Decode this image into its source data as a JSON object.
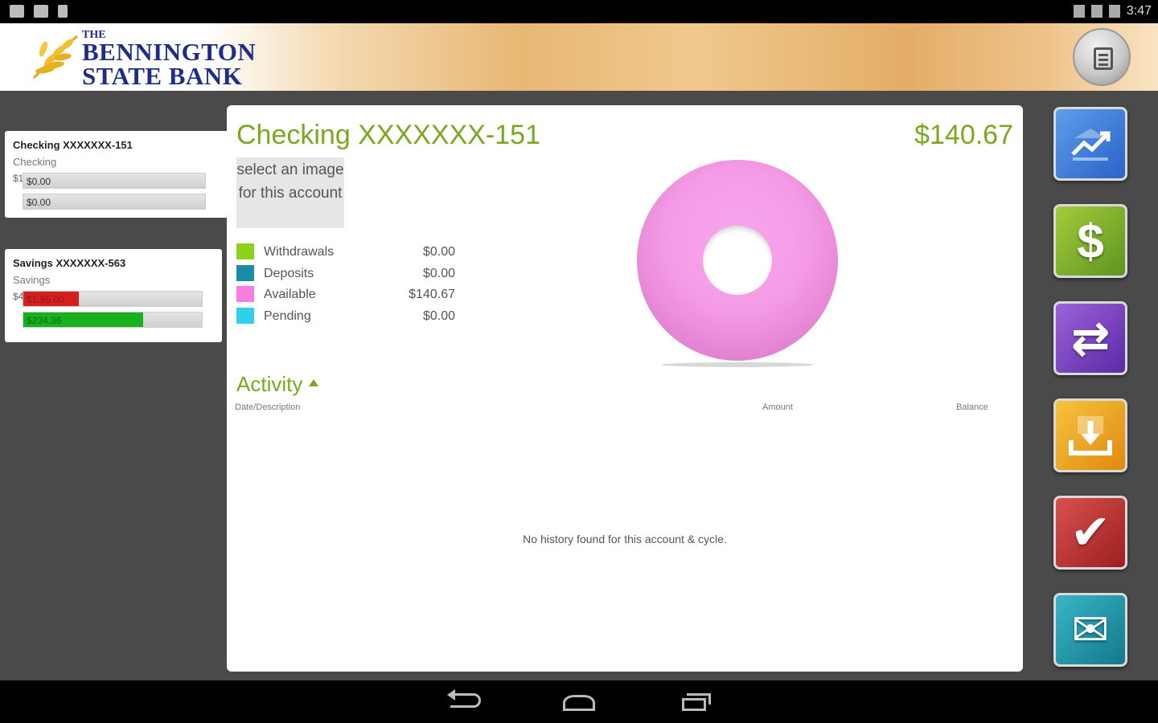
{
  "status_bar": {
    "time": "3:47"
  },
  "brand": {
    "the": "THE",
    "line1": "BENNINGTON",
    "line2": "STATE BANK"
  },
  "accounts": [
    {
      "name": "Checking XXXXXXX-151",
      "type": "Checking",
      "prefix": "$1",
      "bar1_label": "$0.00",
      "bar1_fill": 0,
      "bar2_label": "$0.00",
      "bar2_fill": 0
    },
    {
      "name": "Savings XXXXXXX-563",
      "type": "Savings",
      "prefix": "$4",
      "bar1_label": "$1.95.00",
      "bar1_fill": 0.31,
      "bar2_label": "$234.36",
      "bar2_fill": 0.67
    }
  ],
  "detail": {
    "title": "Checking XXXXXXX-151",
    "balance": "$140.67",
    "image_placeholder": "select an image for this account",
    "legend": [
      {
        "label": "Withdrawals",
        "value": "$0.00",
        "color": "#8fd21c"
      },
      {
        "label": "Deposits",
        "value": "$0.00",
        "color": "#1c8ca6"
      },
      {
        "label": "Available",
        "value": "$140.67",
        "color": "#f57ee0"
      },
      {
        "label": "Pending",
        "value": "$0.00",
        "color": "#2fd0ea"
      }
    ],
    "activity_title": "Activity",
    "columns": {
      "date": "Date/Description",
      "amount": "Amount",
      "balance": "Balance"
    },
    "empty_message": "No history found for this account & cycle."
  },
  "actions": [
    {
      "glyph": "📈",
      "icon": "accounts-chart-icon"
    },
    {
      "glyph": "$",
      "icon": "dollar-icon"
    },
    {
      "glyph": "⇄",
      "icon": "transfer-icon"
    },
    {
      "glyph": "⤓",
      "icon": "deposit-icon"
    },
    {
      "glyph": "✔",
      "icon": "bill-pay-check-icon"
    },
    {
      "glyph": "✉",
      "icon": "contact-icon"
    }
  ]
}
